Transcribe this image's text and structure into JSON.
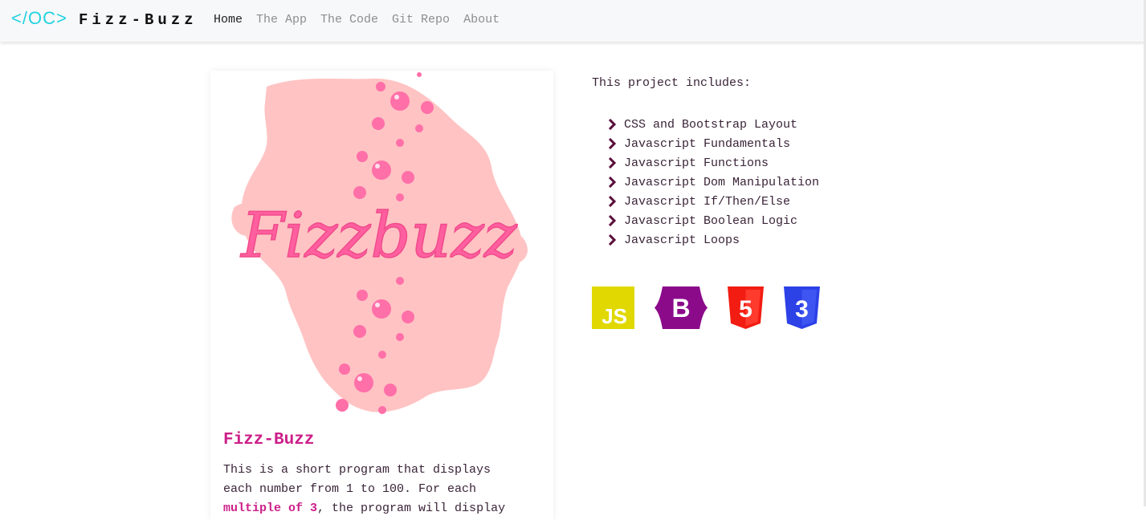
{
  "nav": {
    "logo": "</OC>",
    "brand": "Fizz-Buzz",
    "links": [
      "Home",
      "The App",
      "The Code",
      "Git Repo",
      "About"
    ]
  },
  "card": {
    "image_text": "Fizzbuzz",
    "title": "Fizz-Buzz",
    "text_line1": "This is a short program that displays",
    "text_line2": "each number from 1 to 100. For each",
    "text_highlight": "multiple of 3",
    "text_after": ", the program will display"
  },
  "includes": {
    "heading": "This project includes:",
    "items": [
      "CSS and Bootstrap Layout",
      "Javascript Fundamentals",
      "Javascript Functions",
      "Javascript Dom Manipulation",
      "Javascript If/Then/Else",
      "Javascript Boolean Logic",
      "Javascript Loops"
    ]
  },
  "tech": {
    "js_label": "JS",
    "bootstrap_label": "B",
    "html_label": "5",
    "css_label": "3"
  },
  "colors": {
    "accent": "#cc1f88",
    "logo": "#22d3e0",
    "splash": "#ffc3c3",
    "bubble": "#ff6fa8",
    "js": "#e0d800",
    "bootstrap": "#8b0a8a",
    "html": "#f21c12",
    "css": "#2c41e6"
  }
}
